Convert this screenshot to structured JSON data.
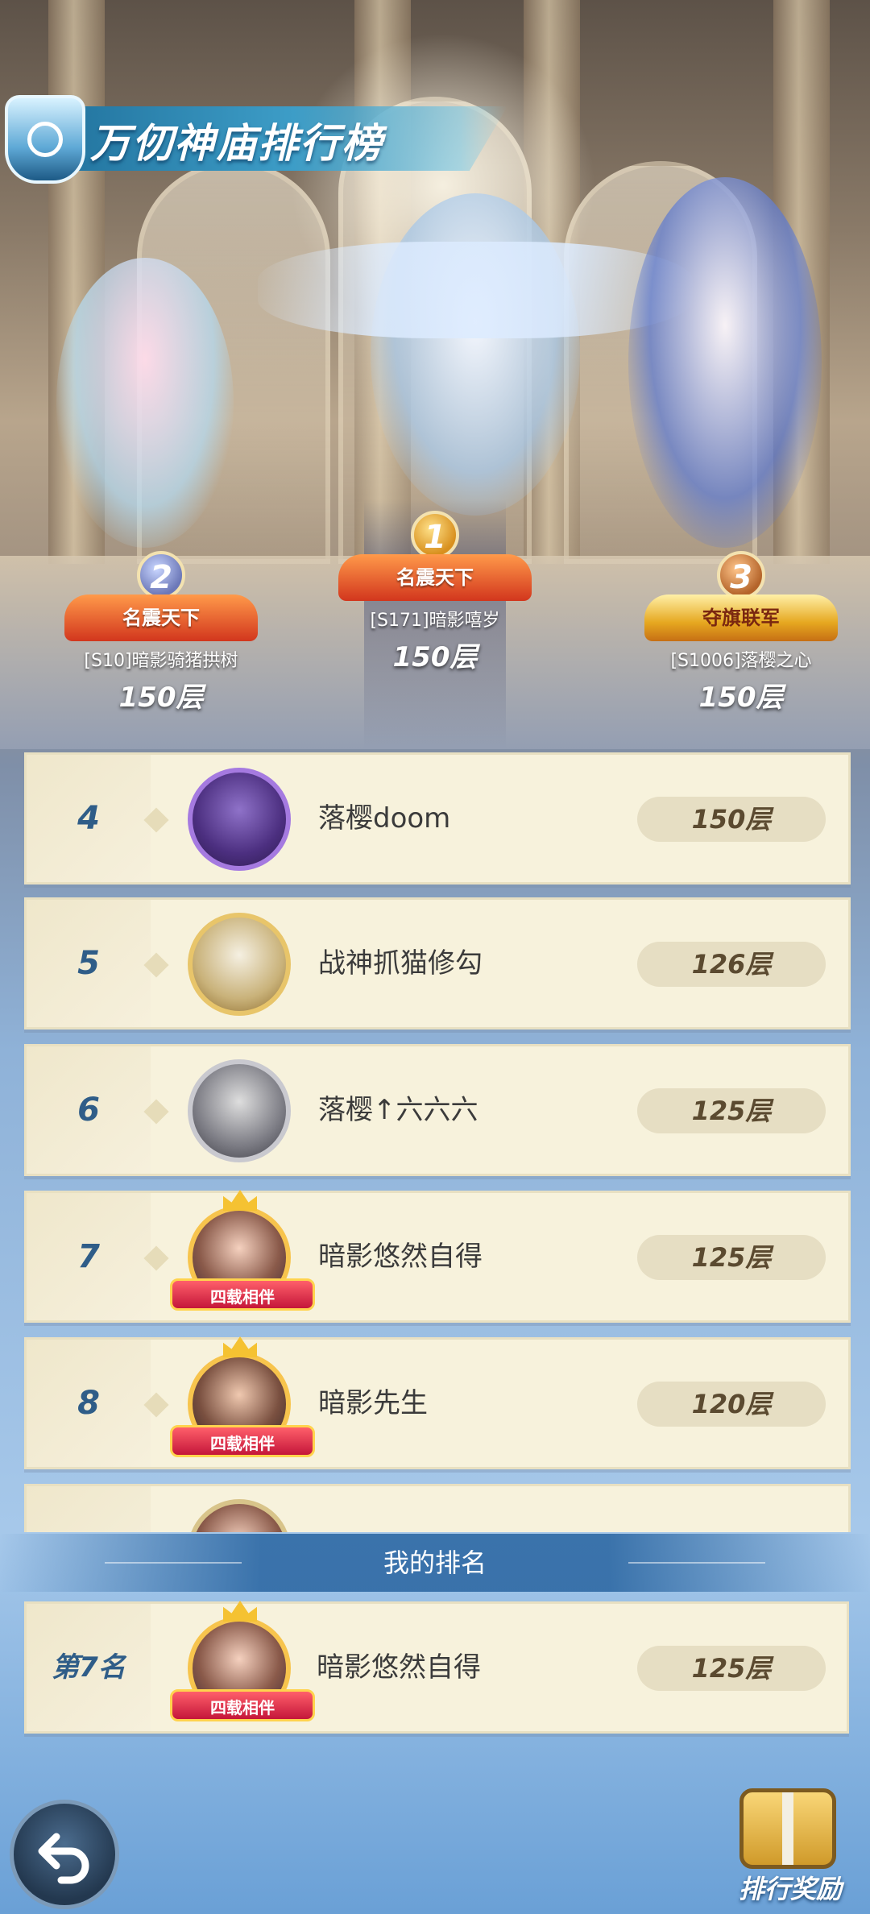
{
  "title": "万仞神庙排行榜",
  "podium": [
    {
      "rank": "2",
      "banner": "名震天下",
      "player": "[S10]暗影骑猪拱树",
      "floors": "150层"
    },
    {
      "rank": "1",
      "banner": "名震天下",
      "player": "[S171]暗影嘻岁",
      "floors": "150层"
    },
    {
      "rank": "3",
      "banner": "夺旗联军",
      "player": "[S1006]落樱之心",
      "floors": "150层"
    }
  ],
  "ranking": [
    {
      "rank": "4",
      "player": "落樱doom",
      "floors": "150层"
    },
    {
      "rank": "5",
      "player": "战神抓猫修勾",
      "floors": "126层"
    },
    {
      "rank": "6",
      "player": "落樱↑六六六",
      "floors": "125层"
    },
    {
      "rank": "7",
      "player": "暗影悠然自得",
      "floors": "125层",
      "badge": "四载相伴"
    },
    {
      "rank": "8",
      "player": "暗影先生",
      "floors": "120层",
      "badge": "四载相伴"
    }
  ],
  "my_ranking": {
    "header": "我的排名",
    "rank": "第7名",
    "player": "暗影悠然自得",
    "floors": "125层",
    "badge": "四载相伴"
  },
  "buttons": {
    "reward": "排行奖励"
  },
  "icons": {
    "back": "back-arrow-icon",
    "reward": "gift-box-icon",
    "title_emblem": "temple-emblem-icon"
  }
}
